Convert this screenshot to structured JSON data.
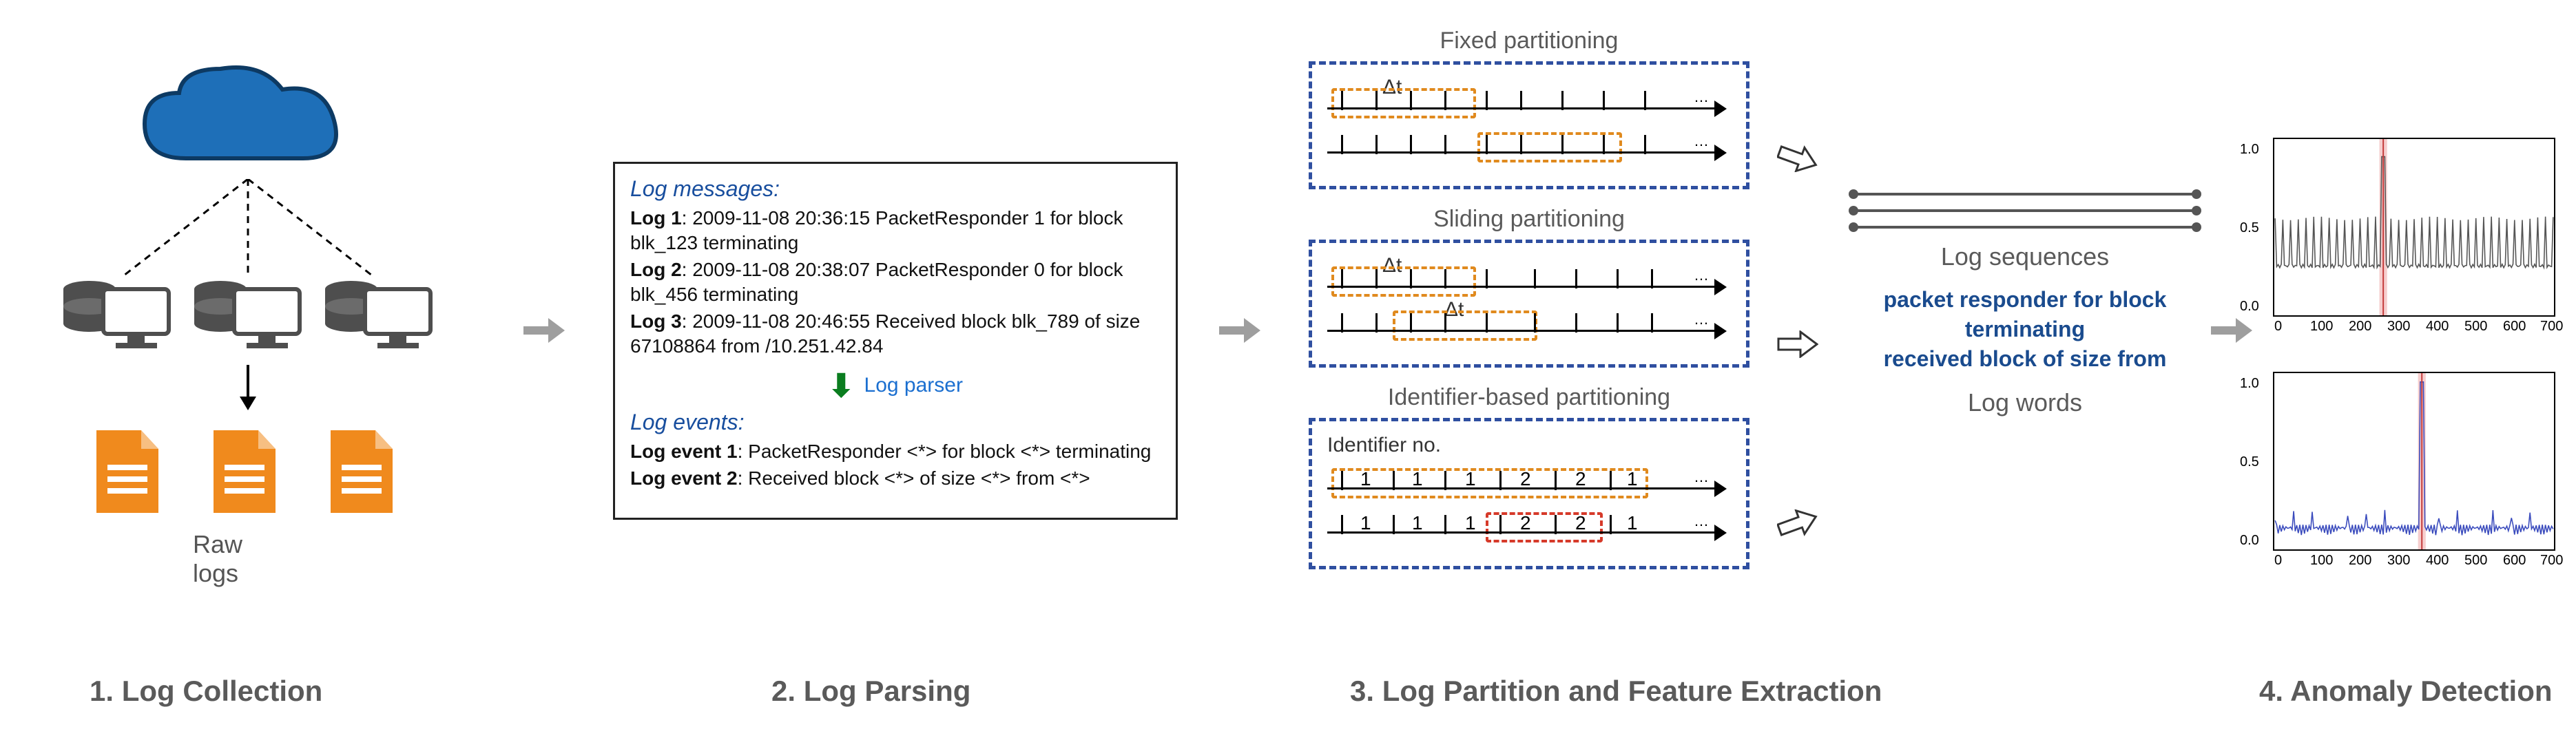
{
  "stages": {
    "s1": "1. Log Collection",
    "s2": "2. Log Parsing",
    "s3": "3. Log Partition and Feature Extraction",
    "s4": "4. Anomaly Detection"
  },
  "collection": {
    "raw_logs_label": "Raw logs"
  },
  "parsing": {
    "messages_heading": "Log messages:",
    "log1_label": "Log 1",
    "log1_text": ": 2009-11-08 20:36:15 PacketResponder 1 for block blk_123 terminating",
    "log2_label": "Log 2",
    "log2_text": ": 2009-11-08 20:38:07 PacketResponder 0 for block blk_456 terminating",
    "log3_label": "Log 3",
    "log3_text": ": 2009-11-08 20:46:55 Received block blk_789 of size 67108864 from /10.251.42.84",
    "parser_label": "Log parser",
    "events_heading": "Log events:",
    "ev1_label": "Log event 1",
    "ev1_text": ": PacketResponder <*> for block <*> terminating",
    "ev2_label": "Log event 2",
    "ev2_text": ": Received block <*> of size <*> from <*>"
  },
  "partition": {
    "fixed_title": "Fixed partitioning",
    "sliding_title": "Sliding partitioning",
    "identifier_title": "Identifier-based partitioning",
    "dt": "Δt",
    "ident_label": "Identifier no.",
    "ident_row1": [
      "1",
      "1",
      "1",
      "2",
      "2",
      "1"
    ],
    "ident_row2": [
      "1",
      "1",
      "1",
      "2",
      "2",
      "1"
    ]
  },
  "output": {
    "sequences_label": "Log sequences",
    "words_label": "Log words",
    "word_line1": "packet responder for block",
    "word_line2": "terminating",
    "word_line3": "received block of size from"
  },
  "anomaly": {
    "ylabels": [
      "0.0",
      "0.5",
      "1.0"
    ],
    "xlabels": [
      "0",
      "100",
      "200",
      "300",
      "400",
      "500",
      "600",
      "700"
    ]
  },
  "chart_data": [
    {
      "type": "line",
      "title": "",
      "xlabel": "",
      "ylabel": "",
      "xlim": [
        0,
        720
      ],
      "ylim": [
        0,
        1.0
      ],
      "highlight_x": [
        270,
        290
      ],
      "series": [
        {
          "name": "signal-1",
          "color": "#555",
          "pattern": "periodic-spikes",
          "baseline": 0.28,
          "peak": 0.55,
          "period": 20,
          "anomaly": {
            "x": 280,
            "y": 0.9
          }
        }
      ]
    },
    {
      "type": "line",
      "title": "",
      "xlabel": "",
      "ylabel": "",
      "xlim": [
        0,
        720
      ],
      "ylim": [
        0,
        1.0
      ],
      "highlight_x": [
        370,
        390
      ],
      "series": [
        {
          "name": "signal-2",
          "color": "#3a4bbd",
          "pattern": "noisy-low",
          "baseline": 0.08,
          "peak": 0.22,
          "anomaly": {
            "x": 380,
            "y": 0.95
          }
        }
      ]
    }
  ]
}
